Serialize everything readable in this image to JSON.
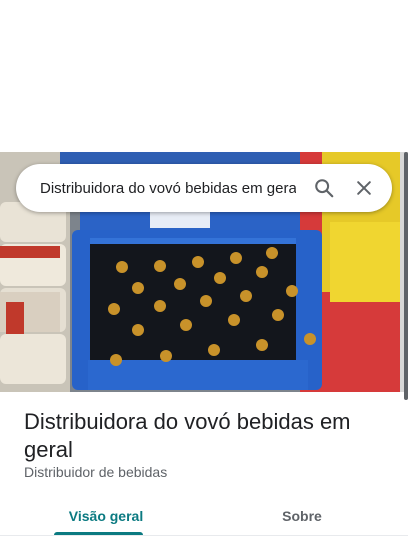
{
  "search": {
    "query": "Distribuidora do vovó bebidas em geral",
    "search_icon": "search-icon",
    "close_icon": "close-icon"
  },
  "place": {
    "name": "Distribuidora do vovó bebidas em geral",
    "category": "Distribuidor de bebidas",
    "photo": "photo of a blue crate of beer bottles"
  },
  "tabs": [
    {
      "label": "Visão geral",
      "selected": true
    },
    {
      "label": "Sobre",
      "selected": false
    }
  ],
  "colors": {
    "accent": "#0b7a81",
    "text_primary": "#202124",
    "text_secondary": "#5f6368"
  }
}
